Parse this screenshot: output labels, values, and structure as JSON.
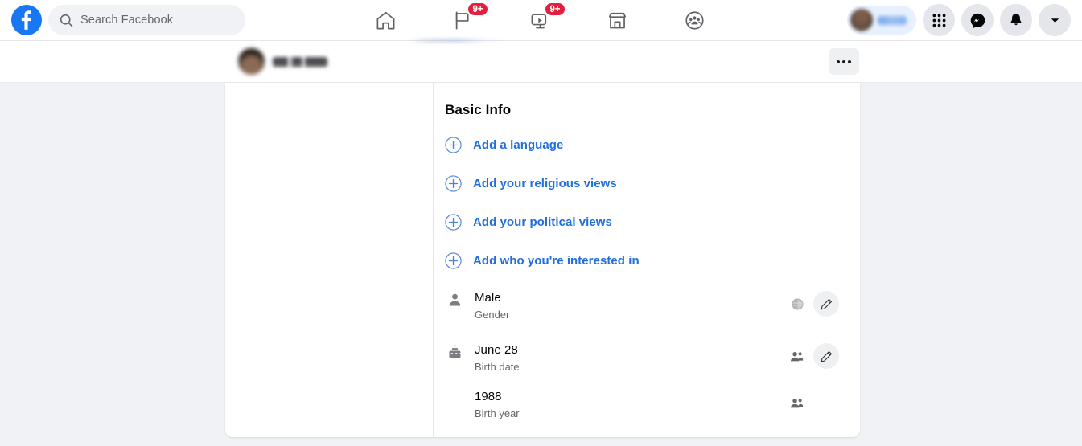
{
  "topnav": {
    "logo_name": "facebook-logo",
    "search": {
      "placeholder": "Search Facebook",
      "icon": "search-icon"
    },
    "tabs": [
      {
        "name": "home",
        "icon": "home-icon",
        "badge": ""
      },
      {
        "name": "pages",
        "icon": "flag-icon",
        "badge": "9+"
      },
      {
        "name": "watch",
        "icon": "video-icon",
        "badge": "9+"
      },
      {
        "name": "marketplace",
        "icon": "marketplace-icon",
        "badge": ""
      },
      {
        "name": "groups",
        "icon": "groups-icon",
        "badge": ""
      }
    ],
    "right": {
      "profile_pill": "account-profile-pill",
      "menu": "grid-menu-icon",
      "messenger": "messenger-icon",
      "notifications": "bell-icon",
      "account": "chevron-down-icon"
    }
  },
  "profile_strip": {
    "avatar": "profile-avatar",
    "name": "",
    "menu_button": "more-options-button"
  },
  "basic_info": {
    "title": "Basic Info",
    "add_items": [
      {
        "label": "Add a language",
        "icon": "plus-circle-icon",
        "name": "add-language"
      },
      {
        "label": "Add your religious views",
        "icon": "plus-circle-icon",
        "name": "add-religious-views"
      },
      {
        "label": "Add your political views",
        "icon": "plus-circle-icon",
        "name": "add-political-views"
      },
      {
        "label": "Add who you're interested in",
        "icon": "plus-circle-icon",
        "name": "add-interested-in"
      }
    ],
    "details": [
      {
        "value": "Male",
        "sub": "Gender",
        "icon": "person-icon",
        "audience": "globe-icon",
        "has_edit": true,
        "name": "gender"
      },
      {
        "value": "June 28",
        "sub": "Birth date",
        "icon": "birthday-cake-icon",
        "audience": "friends-icon",
        "has_edit": true,
        "name": "birth-date"
      },
      {
        "value": "1988",
        "sub": "Birth year",
        "icon": "",
        "audience": "friends-icon",
        "has_edit": false,
        "name": "birth-year"
      }
    ]
  },
  "colors": {
    "brand_blue": "#1877F2",
    "link_blue": "#216FDB",
    "page_bg": "#F0F2F5",
    "badge_red": "#E41E3F",
    "text_primary": "#050505",
    "text_secondary": "#65676B"
  }
}
